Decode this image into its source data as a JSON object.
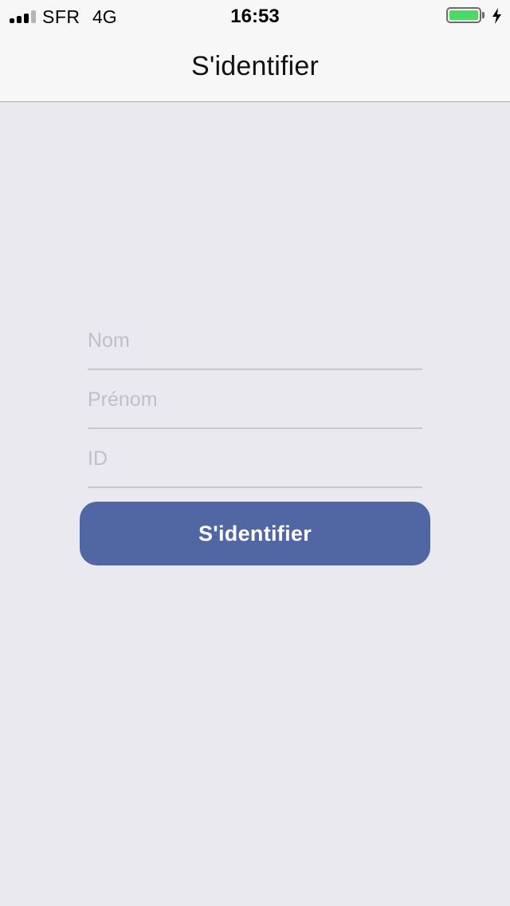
{
  "status_bar": {
    "carrier": "SFR",
    "network": "4G",
    "time": "16:53",
    "battery_color": "#4cd964",
    "battery_level": 1.0,
    "signal_bars": 3,
    "signal_bars_total": 4
  },
  "nav": {
    "title": "S'identifier"
  },
  "form": {
    "nom_placeholder": "Nom",
    "prenom_placeholder": "Prénom",
    "id_placeholder": "ID",
    "submit_label": "S'identifier"
  },
  "colors": {
    "button": "#5167a4",
    "background": "#ebe9f0"
  }
}
